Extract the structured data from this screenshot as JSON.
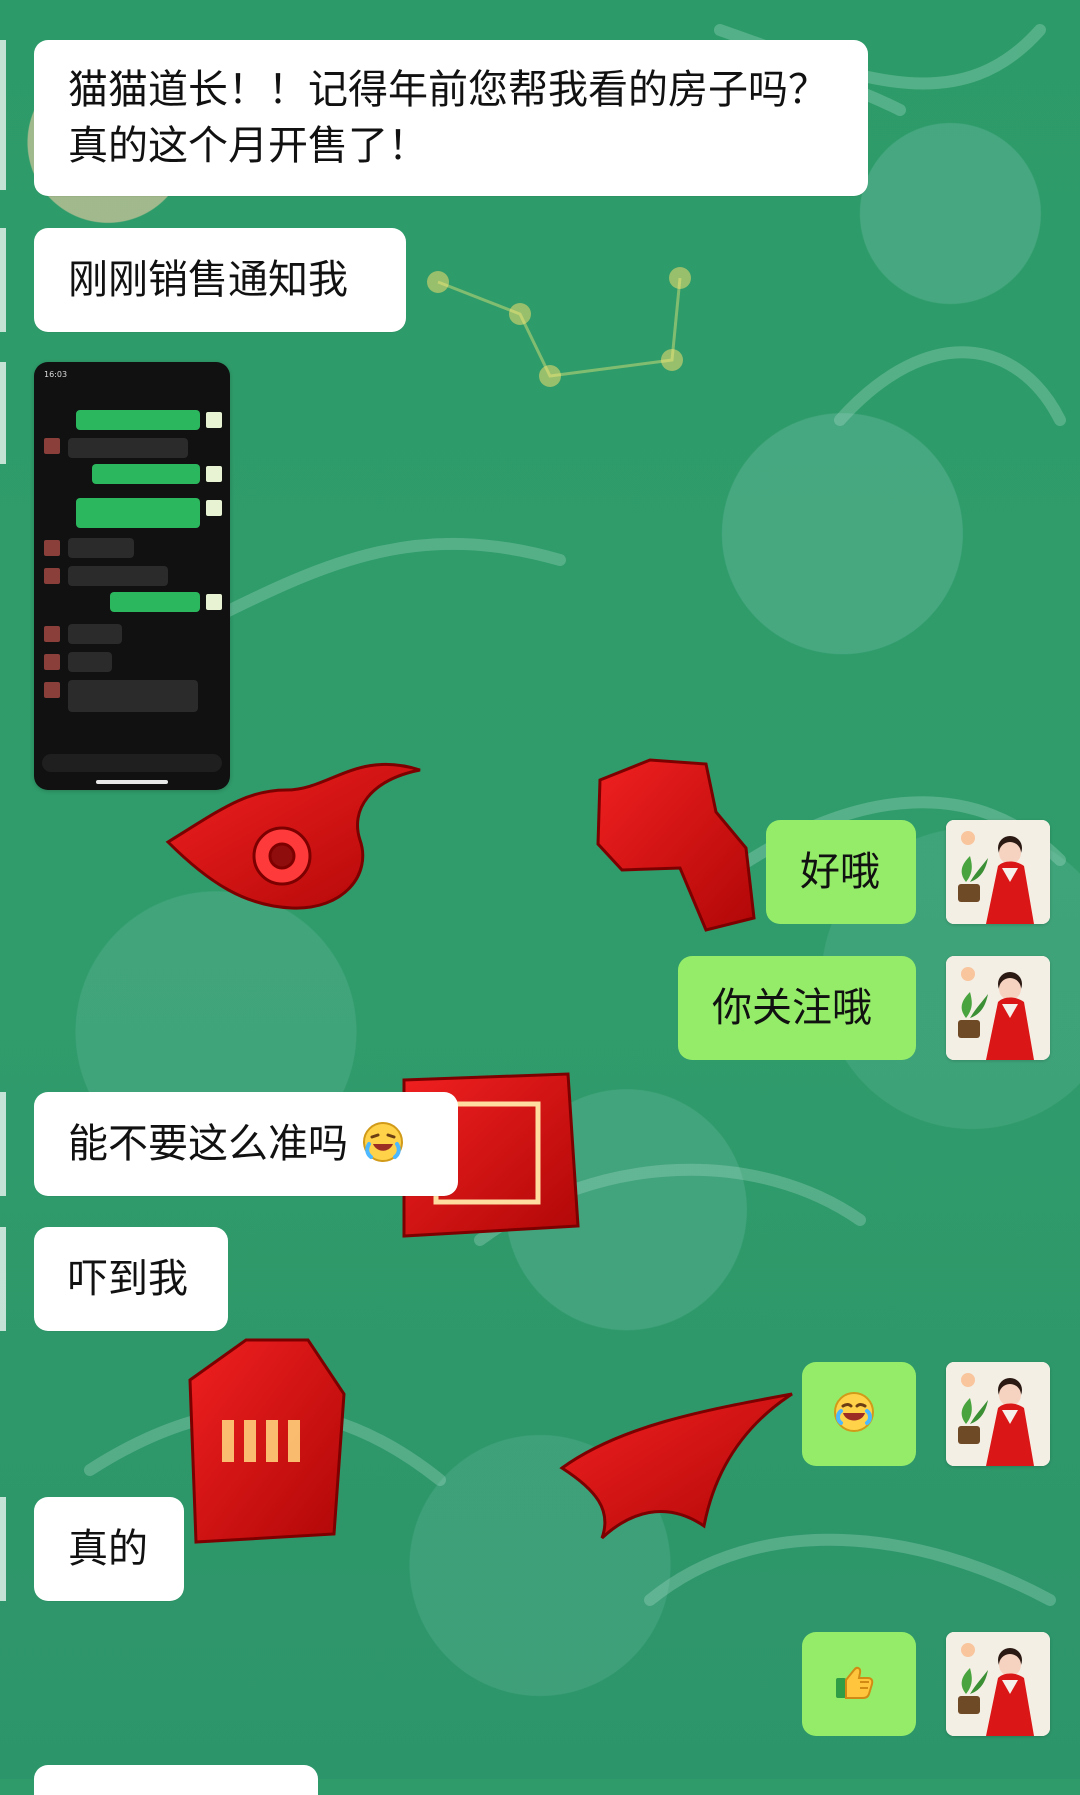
{
  "chat": {
    "messages": [
      {
        "side": "left",
        "text": "猫猫道长！！记得年前您帮我看的房子吗？ 真的这个月开售了！"
      },
      {
        "side": "left",
        "text": "刚刚销售通知我"
      },
      {
        "side": "left",
        "type": "image",
        "image_semantic": "chat-screenshot-image",
        "screenshot": {
          "status_time": "16:03"
        }
      },
      {
        "side": "right",
        "text": "好哦"
      },
      {
        "side": "right",
        "text": "你关注哦"
      },
      {
        "side": "left",
        "text": "能不要这么准吗",
        "emoji": "crying-laughing-face-icon"
      },
      {
        "side": "left",
        "text": "吓到我"
      },
      {
        "side": "right",
        "emoji": "tears-of-joy-face-icon"
      },
      {
        "side": "left",
        "text": "真的"
      },
      {
        "side": "right",
        "emoji": "thumbs-up-icon"
      }
    ]
  },
  "colors": {
    "background": "#2f9a6a",
    "incoming_bubble": "#ffffff",
    "outgoing_bubble": "#95ec69",
    "red_glyphs": "#d41212"
  },
  "icons": {
    "avatar": "avatar-woman-red-hanfu-icon",
    "background_decor": "wechat-chat-background-decoration"
  }
}
